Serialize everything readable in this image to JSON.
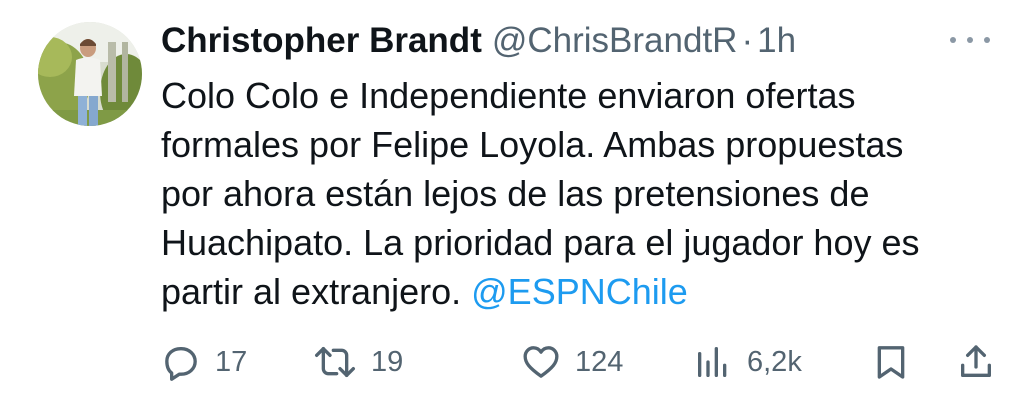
{
  "author": {
    "display_name": "Christopher Brandt",
    "handle": "@ChrisBrandtR",
    "separator": "·",
    "time": "1h"
  },
  "tweet": {
    "lines": [
      "Colo Colo e Independiente enviaron ofertas",
      "formales por Felipe Loyola. Ambas propuestas",
      "por ahora están lejos de las pretensiones de",
      "Huachipato. La prioridad para el jugador hoy es"
    ],
    "last_line_text": "partir al extranjero. ",
    "mention": "@ESPNChile"
  },
  "actions": {
    "replies": "17",
    "retweets": "19",
    "likes": "124",
    "views": "6,2k"
  },
  "icons": {
    "more": "more-icon",
    "reply": "reply-icon",
    "retweet": "retweet-icon",
    "like": "heart-icon",
    "views": "views-icon",
    "bookmark": "bookmark-icon",
    "share": "share-icon"
  },
  "colors": {
    "text": "#0f1419",
    "secondary": "#536471",
    "link": "#1d9bf0"
  }
}
